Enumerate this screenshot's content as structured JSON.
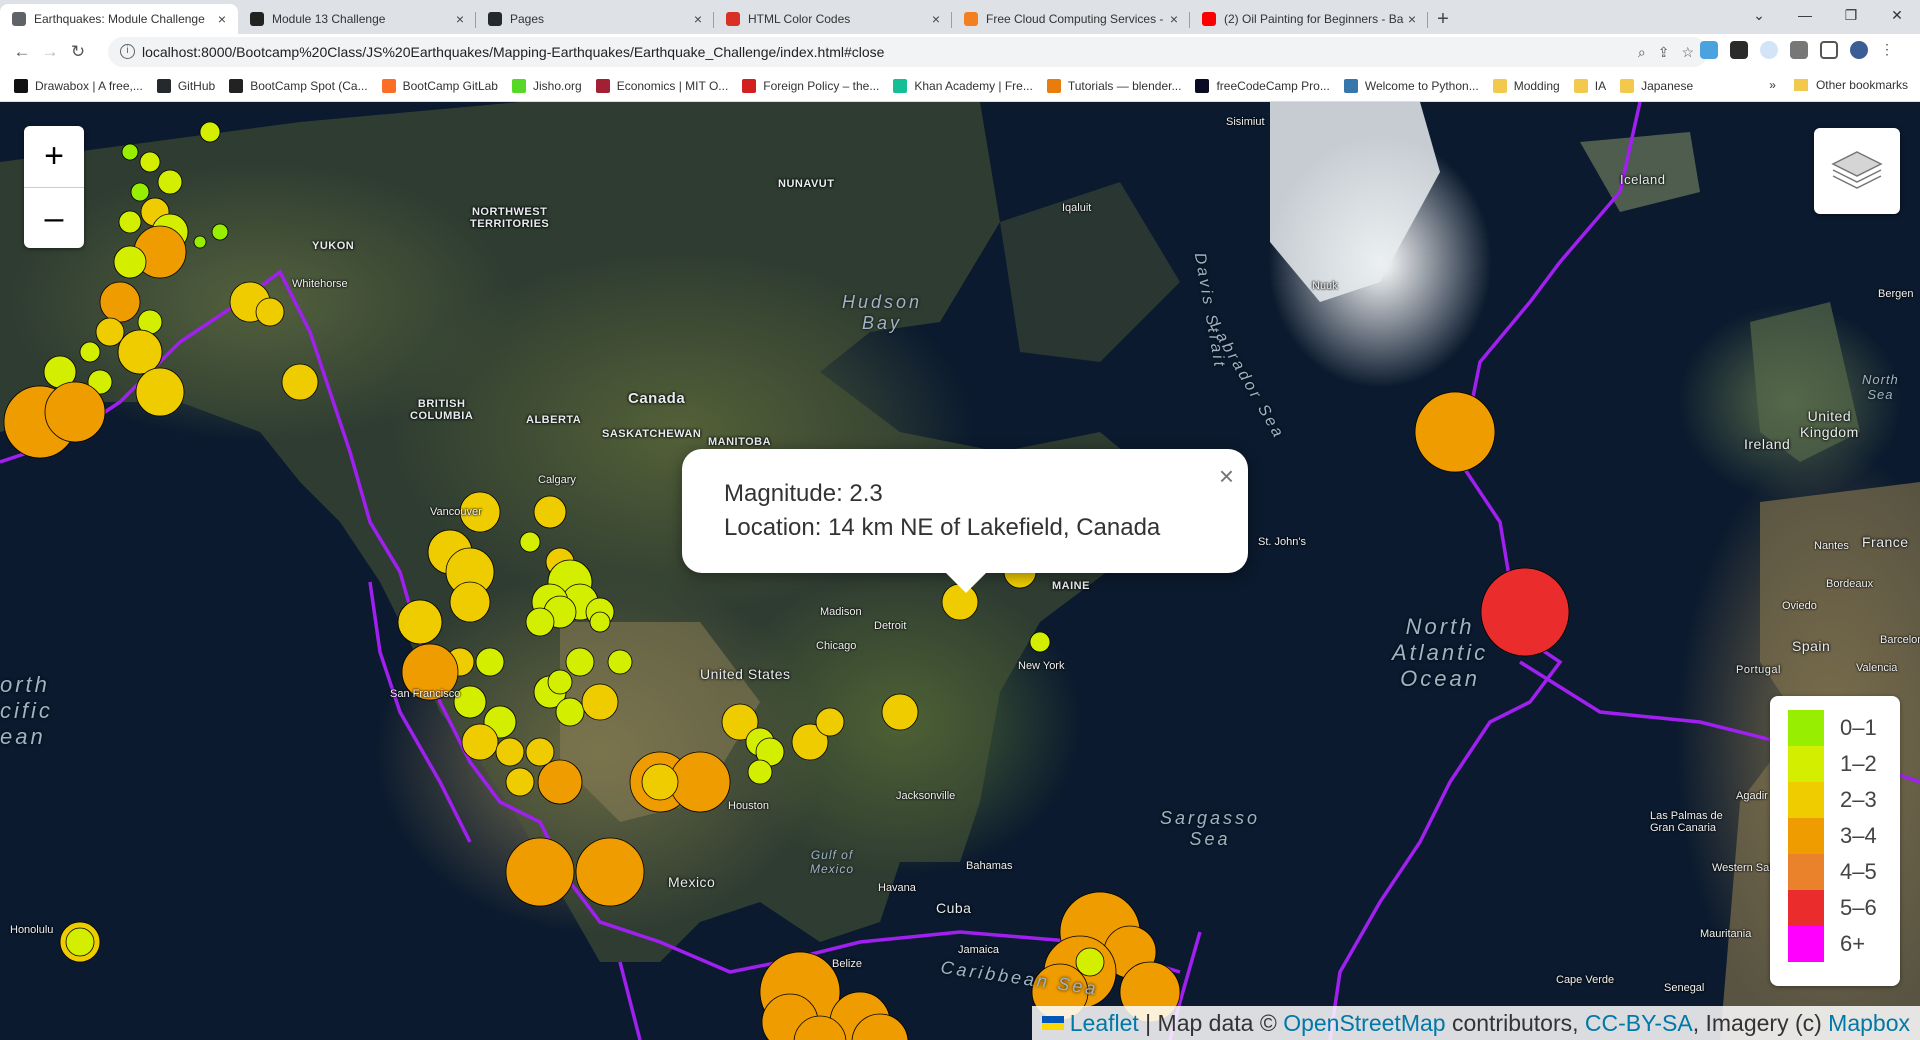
{
  "tabs": [
    {
      "title": "Earthquakes: Module Challenge",
      "favicon_color": "#5f6368",
      "active": true
    },
    {
      "title": "Module 13 Challenge",
      "favicon_color": "#222222",
      "active": false
    },
    {
      "title": "Pages",
      "favicon_color": "#24292e",
      "active": false
    },
    {
      "title": "HTML Color Codes",
      "favicon_color": "#d93025",
      "active": false
    },
    {
      "title": "Free Cloud Computing Services -",
      "favicon_color": "#f38020",
      "active": false
    },
    {
      "title": "(2) Oil Painting for Beginners - Ba",
      "favicon_color": "#ff0000",
      "active": false
    }
  ],
  "address": {
    "url": "localhost:8000/Bootcamp%20Class/JS%20Earthquakes/Mapping-Earthquakes/Earthquake_Challenge/index.html#close"
  },
  "bookmarks": [
    {
      "label": "Drawabox | A free,...",
      "color": "#111111"
    },
    {
      "label": "GitHub",
      "color": "#24292e"
    },
    {
      "label": "BootCamp Spot (Ca...",
      "color": "#222222"
    },
    {
      "label": "BootCamp GitLab",
      "color": "#fc6d26"
    },
    {
      "label": "Jisho.org",
      "color": "#56d926"
    },
    {
      "label": "Economics | MIT O...",
      "color": "#a31f34"
    },
    {
      "label": "Foreign Policy – the...",
      "color": "#d21f1f"
    },
    {
      "label": "Khan Academy | Fre...",
      "color": "#14bf96"
    },
    {
      "label": "Tutorials — blender...",
      "color": "#e87d0d"
    },
    {
      "label": "freeCodeCamp Pro...",
      "color": "#0a0a23"
    },
    {
      "label": "Welcome to Python...",
      "color": "#3776ab"
    },
    {
      "label": "Modding",
      "color": "#f2c94c"
    },
    {
      "label": "IA",
      "color": "#f2c94c"
    },
    {
      "label": "Japanese",
      "color": "#f2c94c"
    }
  ],
  "bookmarks_more": "»",
  "other_bookmarks": "Other bookmarks",
  "zoom": {
    "in": "+",
    "out": "–"
  },
  "popup": {
    "magnitude": "Magnitude: 2.3",
    "location": "Location: 14 km NE of Lakefield, Canada",
    "close": "×"
  },
  "legend": [
    {
      "label": "0–1",
      "color": "#98ee00"
    },
    {
      "label": "1–2",
      "color": "#d4ee00"
    },
    {
      "label": "2–3",
      "color": "#eecc00"
    },
    {
      "label": "3–4",
      "color": "#ee9c00"
    },
    {
      "label": "4–5",
      "color": "#ea822c"
    },
    {
      "label": "5–6",
      "color": "#ea2c2c"
    },
    {
      "label": "6+",
      "color": "#ff00ff"
    }
  ],
  "attribution": {
    "leaflet": "Leaflet",
    "map_data": " | Map data © ",
    "osm": "OpenStreetMap",
    "contributors": " contributors, ",
    "license": "CC-BY-SA",
    "imagery": ", Imagery (c) ",
    "mapbox": "Mapbox"
  },
  "map_labels": {
    "canada": "Canada",
    "united_states": "United States",
    "mexico": "Mexico",
    "cuba": "Cuba",
    "iceland": "Iceland",
    "ireland": "Ireland",
    "united_kingdom": "United\nKingdom",
    "france": "France",
    "spain": "Spain",
    "portugal": "Portugal",
    "nunavut": "NUNAVUT",
    "nw_territories": "NORTHWEST\nTERRITORIES",
    "yukon": "YUKON",
    "british_columbia": "BRITISH\nCOLUMBIA",
    "alberta": "ALBERTA",
    "saskatchewan": "SASKATCHEWAN",
    "manitoba": "MANITOBA",
    "maine": "MAINE",
    "hudson_bay": "Hudson\nBay",
    "davis_strait": "Davis Strait",
    "labrador_sea": "Labrador Sea",
    "north_atlantic": "North\nAtlantic\nOcean",
    "north_pacific": "orth\ncific\nean",
    "sargasso": "Sargasso\nSea",
    "gulf_mexico": "Gulf of\nMexico",
    "caribbean": "Caribbean Sea",
    "north_sea": "North\nSea"
  },
  "cities": [
    "Whitehorse",
    "Calgary",
    "Vancouver",
    "San Francisco",
    "Honolulu",
    "Chicago",
    "Detroit",
    "New York",
    "Houston",
    "Jacksonville",
    "Havana",
    "Bahamas",
    "Jamaica",
    "Belize",
    "St. John's",
    "Nuuk",
    "Iqaluit",
    "Sisimiut",
    "Bergen",
    "Nantes",
    "Bordeaux",
    "Oviedo",
    "Valencia",
    "Barcelona",
    "Agadir",
    "Las Palmas de Gran Canaria",
    "Western Sahara",
    "Mauritania",
    "Senegal",
    "Cape Verde",
    "Madison"
  ],
  "quakes": [
    {
      "mag": 2.3,
      "color": "#eecc00"
    },
    {
      "mag": 6.0,
      "color": "#ea2c2c"
    },
    {
      "mag": 3.8,
      "color": "#ee9c00"
    }
  ]
}
